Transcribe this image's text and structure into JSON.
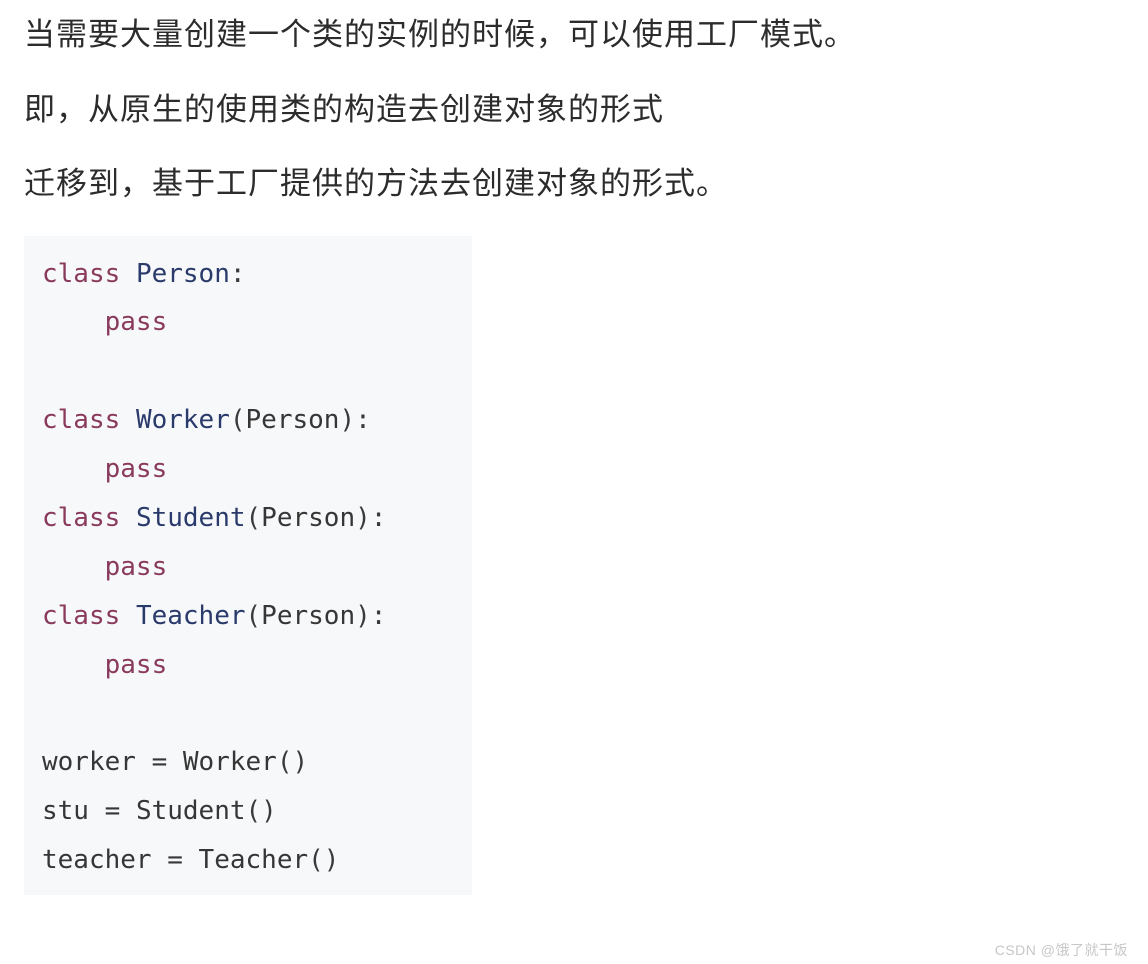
{
  "paragraphs": {
    "p1": "当需要大量创建一个类的实例的时候，可以使用工厂模式。",
    "p2": "即，从原生的使用类的构造去创建对象的形式",
    "p3": "迁移到，基于工厂提供的方法去创建对象的形式。"
  },
  "code": {
    "kw_class": "class",
    "kw_pass": "pass",
    "cls_person": "Person",
    "cls_worker": "Worker",
    "cls_student": "Student",
    "cls_teacher": "Teacher",
    "var_worker": "worker",
    "var_stu": "stu",
    "var_teacher": "teacher",
    "eq": " = ",
    "lparen": "(",
    "rparen": ")",
    "colon": ":",
    "indent": "    "
  },
  "watermark": "CSDN @饿了就干饭"
}
